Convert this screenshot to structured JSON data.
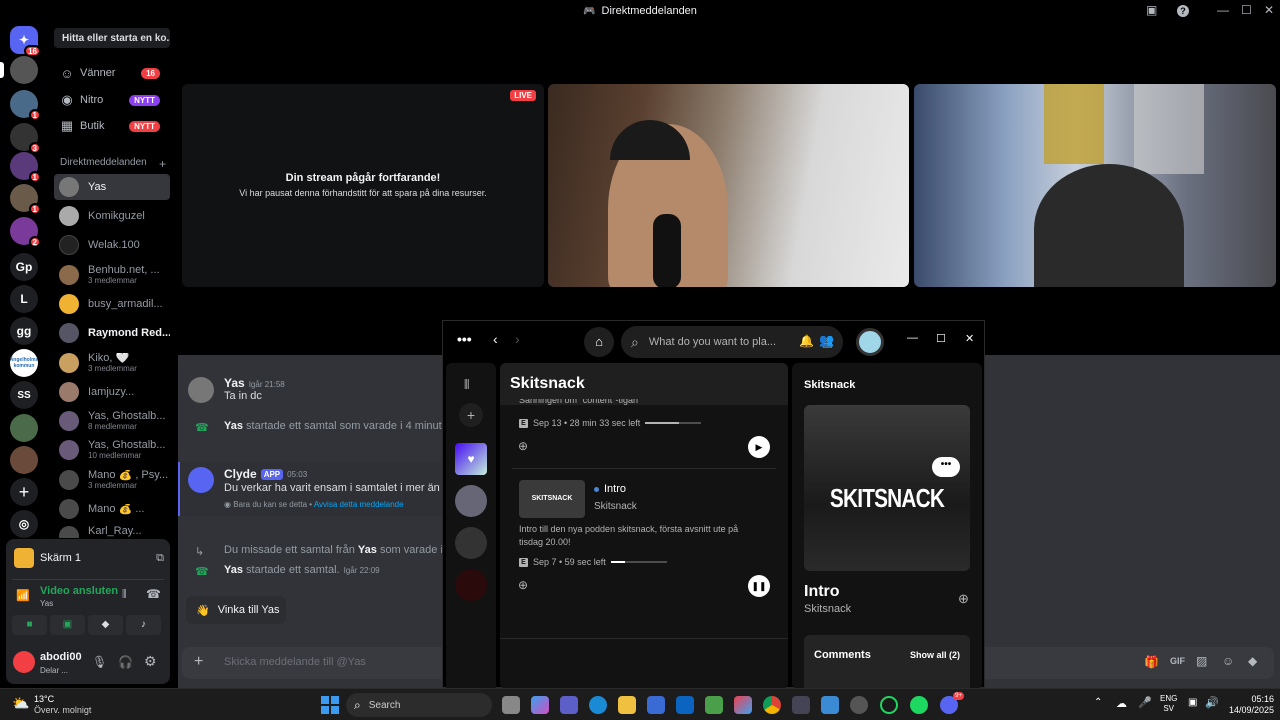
{
  "window": {
    "title": "Direktmeddelanden"
  },
  "sidebar": {
    "search": "Hitta eller starta en ko...",
    "nav": [
      {
        "label": "Vänner",
        "icon": "friends-icon",
        "badge": "16"
      },
      {
        "label": "Nitro",
        "icon": "nitro-icon",
        "badge": "NYTT"
      },
      {
        "label": "Butik",
        "icon": "shop-icon",
        "badge": "NYTT"
      }
    ],
    "dm_header": "Direktmeddelanden",
    "dms": [
      {
        "name": "Yas",
        "sub": ""
      },
      {
        "name": "Komikguzel",
        "sub": ""
      },
      {
        "name": "Welak.100",
        "sub": ""
      },
      {
        "name": "Benhub.net, ...",
        "sub": "3 medlemmar"
      },
      {
        "name": "busy_armadil...",
        "sub": ""
      },
      {
        "name": "Raymond Red...",
        "sub": ""
      },
      {
        "name": "Kiko, 🤍",
        "sub": "3 medlemmar"
      },
      {
        "name": "Iamjuzy...",
        "sub": ""
      },
      {
        "name": "Yas, Ghostalb...",
        "sub": "8 medlemmar"
      },
      {
        "name": "Yas, Ghostalb...",
        "sub": "10 medlemmar"
      },
      {
        "name": "Mano 💰 , Psy...",
        "sub": "3 medlemmar"
      },
      {
        "name": "Mano 💰 ...",
        "sub": ""
      },
      {
        "name": "Karl_Ray...",
        "sub": ""
      }
    ]
  },
  "guilds": {
    "home_badge": "16",
    "badges": [
      "1",
      "3",
      "1",
      "1",
      "2"
    ],
    "letters": [
      "Gp",
      "L",
      "gg",
      "Ängelholms kommun",
      "SS"
    ]
  },
  "voice_panel": {
    "screen_label": "Skärm 1",
    "status": "Video ansluten",
    "channel": "Yas"
  },
  "user": {
    "name": "abodi00",
    "status": "Delar ..."
  },
  "stage": {
    "live": "LIVE",
    "paused_title": "Din stream pågår fortfarande!",
    "paused_sub": "Vi har pausat denna förhandstitt för att spara på dina resurser."
  },
  "chat": {
    "msg1_author": "Yas",
    "msg1_time": "Igår 21:58",
    "msg1_text": "Ta in dc",
    "call1": "startade ett samtal som varade i 4 minuter.",
    "call1_user": "Yas",
    "bot_author": "Clyde",
    "bot_tag": "APP",
    "bot_time": "05:03",
    "bot_text": "Du verkar ha varit ensam i samtalet i mer än 3 m",
    "bot_note": "Bara du kan se detta •",
    "bot_dismiss": "Avvisa detta meddelande",
    "missed_a": "Du missade ett samtal från",
    "missed_user": "Yas",
    "missed_b": "som varade i någ",
    "call2_user": "Yas",
    "call2": "startade ett samtal.",
    "call2_time": "Igår 22:09",
    "wave": "Vinka till Yas",
    "input_placeholder": "Skicka meddelande till @Yas"
  },
  "spotify": {
    "search_placeholder": "What do you want to pla...",
    "panel_title": "Skitsnack",
    "ep1_top": "Sanningen om \"content\"-tigan",
    "ep1_meta": "Sep 13 • 28 min 33 sec left",
    "ep1_progress": 0.6,
    "ep2_title": "Intro",
    "ep2_show": "Skitsnack",
    "ep2_desc": "Intro till den nya podden skitsnack, första avsnitt ute på tisdag 20.00!",
    "ep2_meta": "Sep 7 • 59 sec left",
    "ep2_progress": 0.25,
    "np_show": "Skitsnack",
    "np_cover": "SKITSNACK",
    "np_title": "Intro",
    "np_sub": "Skitsnack",
    "comments": "Comments",
    "show_all": "Show all (2)"
  },
  "taskbar": {
    "temp": "13°C",
    "weather": "Överv. molnigt",
    "search": "Search",
    "lang1": "ENG",
    "lang2": "SV",
    "time": "05:16",
    "date": "14/09/2025",
    "discord_badge": "9+"
  }
}
